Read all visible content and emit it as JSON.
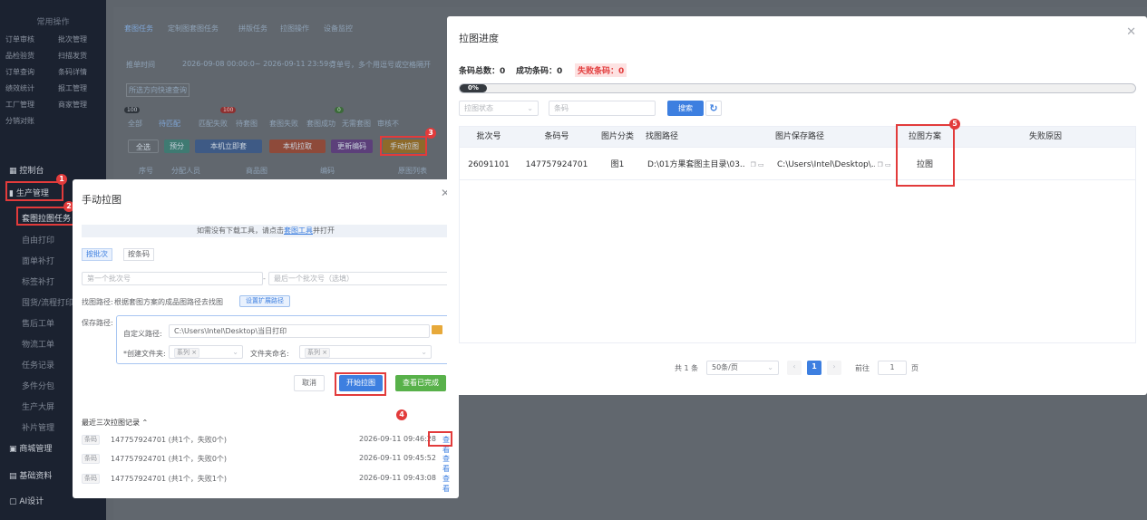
{
  "sidebar": {
    "quick_ops_title": "常用操作",
    "quick_ops": [
      "订单审核",
      "批次管理",
      "品检验货",
      "扫描发货",
      "订单查询",
      "条码详情",
      "绩效统计",
      "报工管理",
      "工厂管理",
      "商家管理",
      "分销对账"
    ],
    "console": "控制台",
    "production": "生产管理",
    "sub_items": [
      "套图拉图任务",
      "自由打印",
      "面单补打",
      "标签补打",
      "囤货/流程打印",
      "售后工单",
      "物流工单",
      "任务记录",
      "多件分包",
      "生产大屏",
      "补片管理"
    ],
    "mall": "商城管理",
    "base": "基础资料",
    "ai": "AI设计"
  },
  "background": {
    "tabs": [
      "套图任务",
      "定制图套图任务",
      "拼版任务",
      "拉图操作",
      "设备监控"
    ],
    "time_select": "推单时间",
    "time_range": "2026-09-08 00:00:0~ 2026-09-11 23:59:5",
    "search_hint": "订单号，多个用逗号或空格隔开",
    "quick_query": "所选方向快速查询",
    "status_tabs": [
      "全部",
      "待匹配",
      "匹配失败",
      "待套图",
      "套图失败",
      "套图成功",
      "无需套图",
      "审核不"
    ],
    "status_counts": [
      "100",
      "100",
      "0"
    ],
    "actions": [
      "全选",
      "预分",
      "本机立即套",
      "本机拉取",
      "更新编码",
      "手动拉图"
    ],
    "columns": [
      "序号",
      "分配人员",
      "商品图",
      "编码",
      "原图列表"
    ]
  },
  "manual": {
    "title": "手动拉图",
    "notice_prefix": "如需没有下载工具，请点击",
    "notice_link": "套图工具",
    "notice_suffix": "并打开",
    "tab_batch": "按批次",
    "tab_barcode": "按条码",
    "first_batch_placeholder": "第一个批次号",
    "last_batch_placeholder": "最后一个批次号（选填）",
    "find_path_label": "找图路径:",
    "find_path_text": "根据套图方案的成品图路径去找图",
    "find_path_button": "设置扩展路径",
    "save_path_label": "保存路径:",
    "custom_path_label": "自定义路径:",
    "custom_path_value": "C:\\Users\\Intel\\Desktop\\当日打印",
    "create_folder_label": "*创建文件夹:",
    "folder_tag": "系列 ×",
    "folder_name_label": "文件夹命名:",
    "folder_name_tag": "系列 ×",
    "cancel": "取消",
    "start": "开始拉图",
    "view_done": "查看已完成",
    "history_title": "最近三次拉图记录",
    "records": [
      {
        "tag": "条码",
        "content": "147757924701 (共1个，失败0个)",
        "time": "2026-09-11 09:46:28",
        "action": "查看"
      },
      {
        "tag": "条码",
        "content": "147757924701 (共1个，失败0个)",
        "time": "2026-09-11 09:45:52",
        "action": "查看"
      },
      {
        "tag": "条码",
        "content": "147757924701 (共1个，失败1个)",
        "time": "2026-09-11 09:43:08",
        "action": "查看"
      }
    ]
  },
  "progress": {
    "title": "拉图进度",
    "total_label": "条码总数：0",
    "success_label": "成功条码：0",
    "fail_label": "失败条码：0",
    "percent_text": "0%",
    "percent": 0.04,
    "status_placeholder": "拉图状态",
    "barcode_placeholder": "条码",
    "search": "搜索",
    "refresh_icon": "refresh-icon",
    "columns": [
      "批次号",
      "条码号",
      "图片分类",
      "找图路径",
      "图片保存路径",
      "拉图方案",
      "失败原因"
    ],
    "rows": [
      {
        "batch": "26091101",
        "barcode": "147757924701",
        "category": "图1",
        "find_path": "D:\\01方果套图主目录\\03...",
        "save_path": "C:\\Users\\Intel\\Desktop\\...",
        "plan": "拉图",
        "reason": ""
      }
    ],
    "pagination": {
      "total": "共 1 条",
      "page_size": "50条/页",
      "current": "1",
      "goto_label": "前往",
      "goto_value": "1",
      "page_unit": "页"
    }
  },
  "annotations": [
    "1",
    "2",
    "3",
    "4",
    "5"
  ],
  "colors": {
    "accent": "#3d7fe0",
    "danger": "#e23b3b",
    "success": "#58b14a"
  }
}
